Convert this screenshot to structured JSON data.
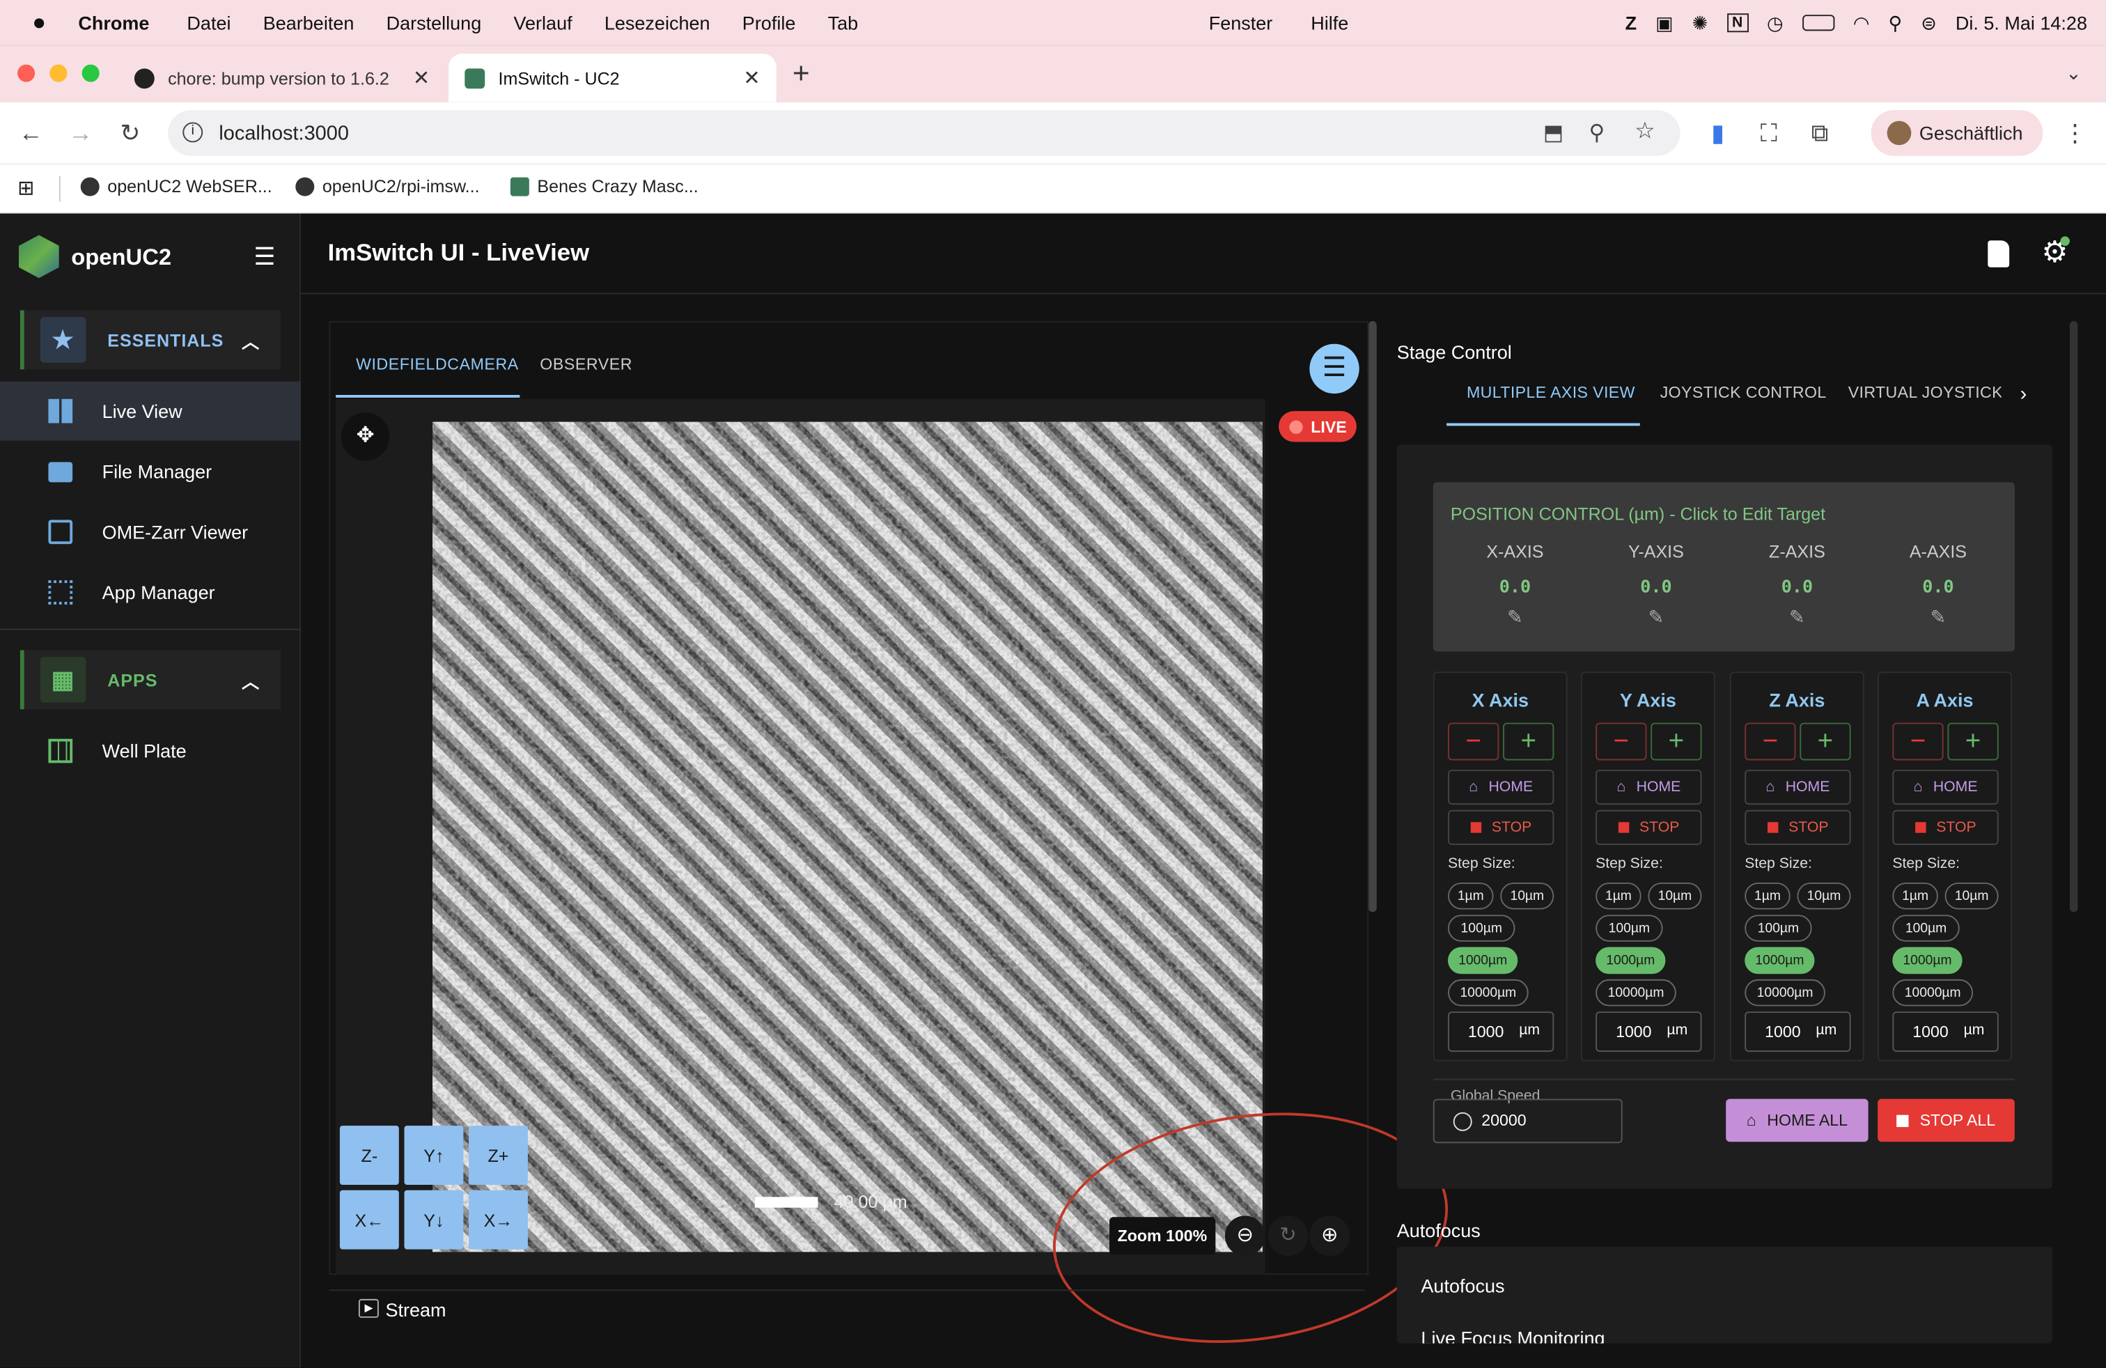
{
  "menubar": {
    "app_name": "Chrome",
    "items": [
      "Datei",
      "Bearbeiten",
      "Darstellung",
      "Verlauf",
      "Lesezeichen",
      "Profile",
      "Tab",
      "Fenster",
      "Hilfe"
    ],
    "datetime": "Di. 5. Mai  14:28"
  },
  "tabs": [
    {
      "title": "chore: bump version to 1.6.2"
    },
    {
      "title": "ImSwitch - UC2"
    }
  ],
  "toolbar": {
    "url": "localhost:3000",
    "profile": "Geschäftlich"
  },
  "bookmarks": [
    "openUC2 WebSER...",
    "openUC2/rpi-imsw...",
    "Benes Crazy Masc..."
  ],
  "sidebar": {
    "brand": "openUC2",
    "essentials_label": "ESSENTIALS",
    "apps_label": "APPS",
    "items": [
      {
        "label": "Live View"
      },
      {
        "label": "File Manager"
      },
      {
        "label": "OME-Zarr Viewer"
      },
      {
        "label": "App Manager"
      }
    ],
    "app_items": [
      {
        "label": "Well Plate"
      }
    ]
  },
  "page": {
    "title": "ImSwitch UI - LiveView"
  },
  "viewer": {
    "tabs": [
      "WIDEFIELDCAMERA",
      "OBSERVER"
    ],
    "live_badge": "LIVE",
    "scale_label": "40.00 µm",
    "zoom_label": "Zoom 100%",
    "stream_label": "Stream",
    "joystick": [
      "Z-",
      "Y↑",
      "Z+",
      "X←",
      "Y↓",
      "X→"
    ]
  },
  "stage": {
    "title": "Stage Control",
    "tabs": [
      "MULTIPLE AXIS VIEW",
      "JOYSTICK CONTROL",
      "VIRTUAL JOYSTICK (S"
    ],
    "position_title": "POSITION CONTROL (µm) - Click to Edit Target",
    "axes": [
      {
        "header": "X-AXIS",
        "value": "0.0",
        "title": "X Axis"
      },
      {
        "header": "Y-AXIS",
        "value": "0.0",
        "title": "Y Axis"
      },
      {
        "header": "Z-AXIS",
        "value": "0.0",
        "title": "Z Axis"
      },
      {
        "header": "A-AXIS",
        "value": "0.0",
        "title": "A Axis"
      }
    ],
    "home_label": "HOME",
    "stop_label": "STOP",
    "step_size_label": "Step Size:",
    "steps": [
      "1µm",
      "10µm",
      "100µm",
      "1000µm",
      "10000µm"
    ],
    "selected_step": "1000µm",
    "step_value": "1000",
    "step_unit": "µm",
    "global_speed_label": "Global Speed",
    "global_speed": "20000",
    "home_all": "HOME ALL",
    "stop_all": "STOP ALL"
  },
  "autofocus": {
    "section_title": "Autofocus",
    "items": [
      "Autofocus",
      "Live Focus Monitoring"
    ]
  },
  "colors": {
    "accent_blue": "#90caf9",
    "accent_green": "#66bb6a",
    "stop_red": "#e53935",
    "home_purple": "#ce93d8"
  }
}
